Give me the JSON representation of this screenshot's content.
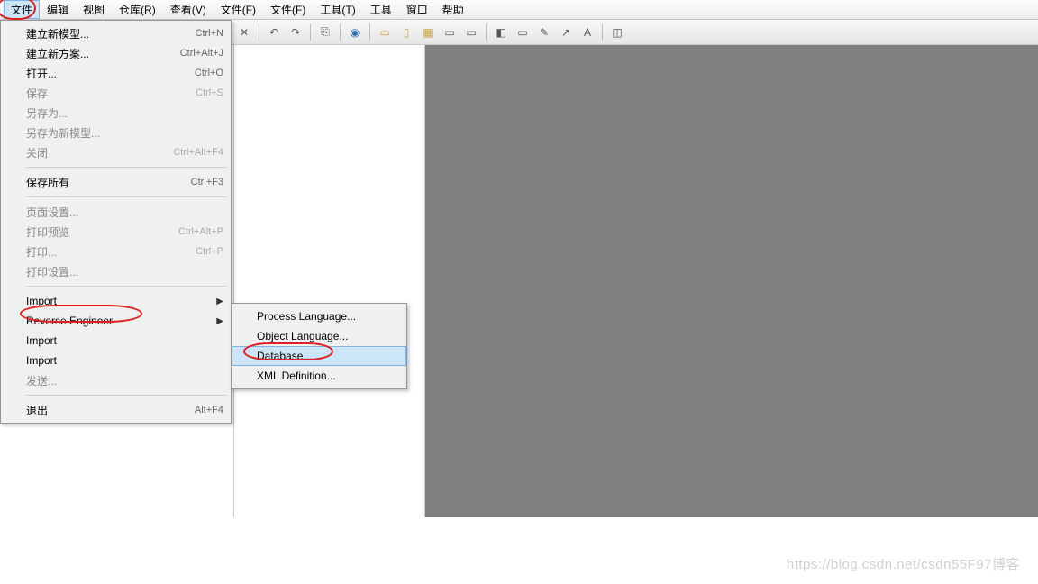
{
  "menubar": {
    "items": [
      {
        "label": "文件"
      },
      {
        "label": "编辑"
      },
      {
        "label": "视图"
      },
      {
        "label": "仓库(R)"
      },
      {
        "label": "查看(V)"
      },
      {
        "label": "文件(F)"
      },
      {
        "label": "文件(F)"
      },
      {
        "label": "工具(T)"
      },
      {
        "label": "工具"
      },
      {
        "label": "窗口"
      },
      {
        "label": "帮助"
      }
    ]
  },
  "dropdown": {
    "section1": [
      {
        "label": "建立新模型...",
        "shortcut": "Ctrl+N"
      },
      {
        "label": "建立新方案...",
        "shortcut": "Ctrl+Alt+J"
      },
      {
        "label": "打开...",
        "shortcut": "Ctrl+O"
      },
      {
        "label": "保存",
        "shortcut": "Ctrl+S"
      },
      {
        "label": "另存为..."
      },
      {
        "label": "另存为新模型..."
      },
      {
        "label": "关闭",
        "shortcut": "Ctrl+Alt+F4"
      }
    ],
    "section2": [
      {
        "label": "保存所有",
        "shortcut": "Ctrl+F3"
      }
    ],
    "section3": [
      {
        "label": "页面设置..."
      },
      {
        "label": "打印预览",
        "shortcut": "Ctrl+Alt+P"
      },
      {
        "label": "打印...",
        "shortcut": "Ctrl+P"
      },
      {
        "label": "打印设置..."
      }
    ],
    "section4": [
      {
        "label": "Import",
        "arrow": true
      },
      {
        "label": "Reverse Engineer",
        "arrow": true
      },
      {
        "label": "Import"
      },
      {
        "label": "Import"
      },
      {
        "label": "发送..."
      }
    ],
    "section5": [
      {
        "label": "退出",
        "shortcut": "Alt+F4"
      }
    ]
  },
  "submenu": {
    "items": [
      {
        "label": "Process Language..."
      },
      {
        "label": "Object Language..."
      },
      {
        "label": "Database..."
      },
      {
        "label": "XML Definition..."
      }
    ]
  },
  "left_panel": {
    "close_x": "x"
  },
  "watermark": "https://blog.csdn.net/csdn55F97博客"
}
